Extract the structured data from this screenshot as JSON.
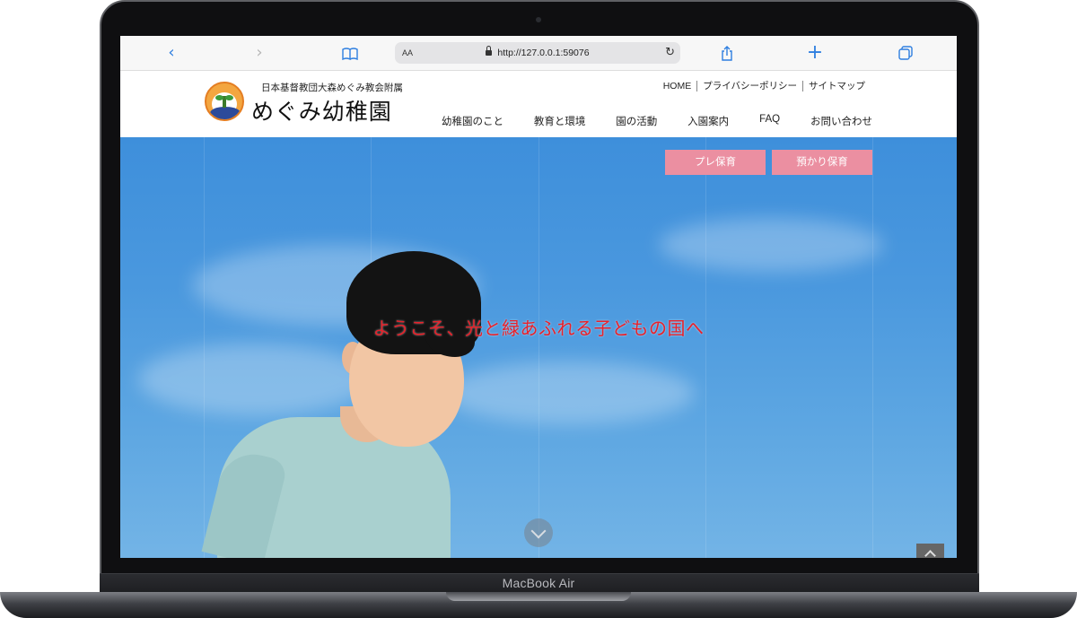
{
  "device": {
    "model_label": "MacBook Air"
  },
  "browser": {
    "text_size_label": "AA",
    "url": "http://127.0.0.1:59076",
    "icons": {
      "back": "chevron-left-icon",
      "forward": "chevron-right-icon",
      "bookmarks": "book-icon",
      "lock": "lock-icon",
      "reload": "reload-icon",
      "share": "share-icon",
      "new_tab": "plus-icon",
      "tabs": "tabs-icon"
    },
    "accent_color": "#2f7fe0"
  },
  "site": {
    "tagline": "日本基督教団大森めぐみ教会附属",
    "name": "めぐみ幼稚園",
    "logo_text": "めぐみ幼稚園",
    "utility_nav": [
      "HOME",
      "プライバシーポリシー",
      "サイトマップ"
    ],
    "main_nav": [
      "幼稚園のこと",
      "教育と環境",
      "園の活動",
      "入園案内",
      "FAQ",
      "お問い合わせ"
    ]
  },
  "hero": {
    "headline": "ようこそ、光と緑あふれる子どもの国へ",
    "headline_color": "#e8212a",
    "buttons": [
      "プレ保育",
      "預かり保育"
    ],
    "button_color": "#eb8fa1",
    "scroll_icon": "chevron-down-icon",
    "to_top_icon": "chevron-up-icon"
  }
}
